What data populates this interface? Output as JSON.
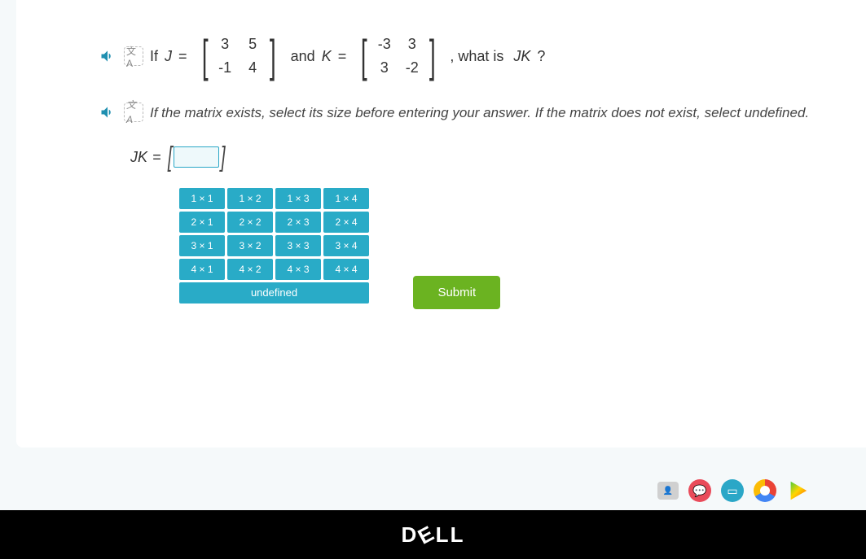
{
  "question": {
    "prefix": "If",
    "var1": "J",
    "eq": "=",
    "matrixJ": [
      [
        "3",
        "5"
      ],
      [
        "-1",
        "4"
      ]
    ],
    "and": "and",
    "var2": "K",
    "matrixK": [
      [
        "-3",
        "3"
      ],
      [
        "3",
        "-2"
      ]
    ],
    "suffix": ", what is",
    "product": "JK",
    "qmark": "?"
  },
  "instruction": "If the matrix exists, select its size before entering your answer. If the matrix does not exist, select undefined.",
  "answer_label": "JK",
  "sizes": [
    [
      "1 × 1",
      "1 × 2",
      "1 × 3",
      "1 × 4"
    ],
    [
      "2 × 1",
      "2 × 2",
      "2 × 3",
      "2 × 4"
    ],
    [
      "3 × 1",
      "3 × 2",
      "3 × 3",
      "3 × 4"
    ],
    [
      "4 × 1",
      "4 × 2",
      "4 × 3",
      "4 × 4"
    ]
  ],
  "undefined_label": "undefined",
  "submit_label": "Submit",
  "logo": {
    "d": "D",
    "e": "E",
    "l1": "L",
    "l2": "L"
  }
}
